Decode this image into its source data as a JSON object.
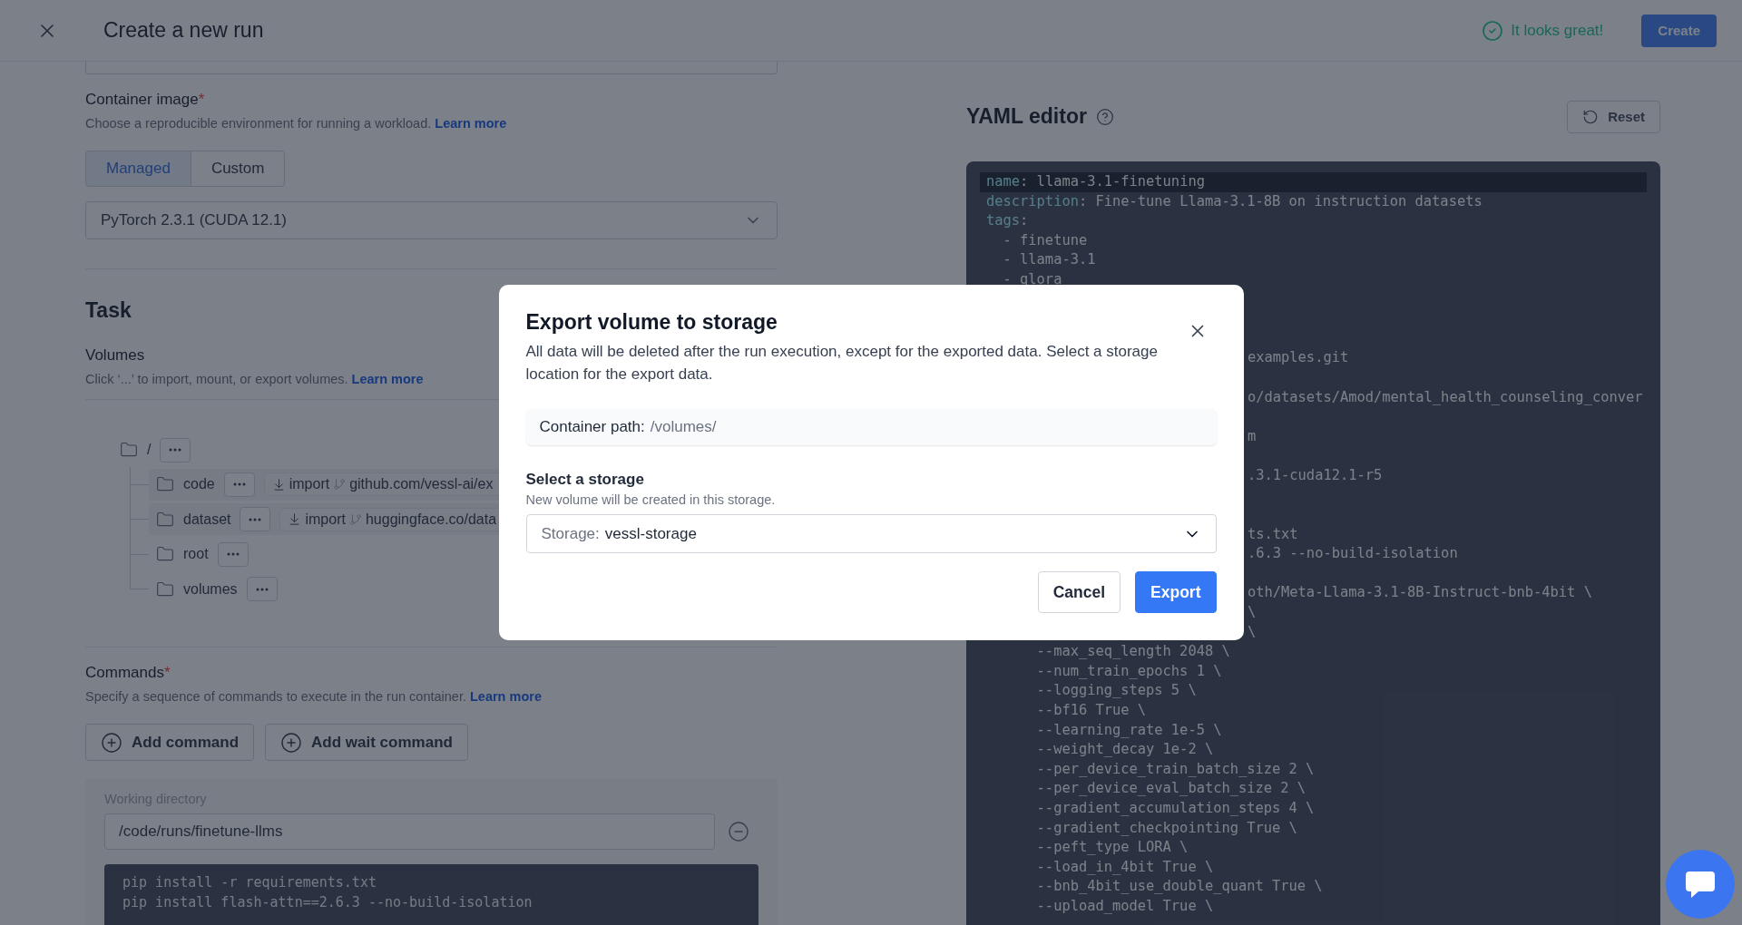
{
  "header": {
    "title": "Create a new run",
    "status": "It looks great!",
    "create_button": "Create"
  },
  "container_image": {
    "label": "Container image",
    "required_mark": "*",
    "description": "Choose a reproducible environment for running a workload.",
    "link": "Learn more",
    "options": [
      {
        "label": "Managed",
        "selected": true
      },
      {
        "label": "Custom",
        "selected": false
      }
    ],
    "image_select": "PyTorch 2.3.1 (CUDA 12.1)"
  },
  "task": {
    "heading": "Task",
    "volumes": {
      "label": "Volumes",
      "description": "Click ‘...’ to import, mount, or export volumes.",
      "link": "Learn more",
      "tree": {
        "name": "/",
        "children": [
          {
            "name": "code",
            "import": {
              "label": "import",
              "source": "github.com/vessl-ai/ex"
            }
          },
          {
            "name": "dataset",
            "import": {
              "label": "import",
              "source": "huggingface.co/data"
            }
          },
          {
            "name": "root"
          },
          {
            "name": "volumes"
          }
        ]
      }
    }
  },
  "commands": {
    "label": "Commands",
    "required_mark": "*",
    "description": "Specify a sequence of commands to execute in the run container.",
    "link": "Learn more",
    "buttons": [
      "Add command",
      "Add wait command"
    ],
    "working_directory": {
      "label": "Working directory",
      "value": "/code/runs/finetune-llms"
    },
    "script": [
      "pip install -r requirements.txt",
      "pip install flash-attn==2.6.3 --no-build-isolation"
    ]
  },
  "yaml_editor": {
    "title": "YAML editor",
    "reset": "Reset",
    "lines": [
      {
        "kind": "full",
        "key": "name",
        "text": ": llama-3.1-finetuning",
        "highlighted": true
      },
      {
        "kind": "full",
        "key": "description",
        "text": ": Fine-tune Llama-3.1-8B on instruction datasets",
        "highlighted": false
      },
      {
        "kind": "full",
        "key": "tags",
        "text": ":",
        "highlighted": false
      },
      {
        "kind": "full",
        "text": "  - finetune",
        "highlighted": false
      },
      {
        "kind": "full",
        "text": "  - llama-3.1",
        "highlighted": false
      },
      {
        "kind": "full",
        "text": "  - qlora",
        "highlighted": false
      },
      {
        "kind": "covered"
      },
      {
        "kind": "covered"
      },
      {
        "kind": "covered"
      },
      {
        "kind": "tail",
        "text": "examples.git",
        "highlighted": false
      },
      {
        "kind": "covered"
      },
      {
        "kind": "tail",
        "text": "o/datasets/Amod/mental_health_counseling_conver",
        "highlighted": false
      },
      {
        "kind": "covered"
      },
      {
        "kind": "tail",
        "text": "m",
        "highlighted": false
      },
      {
        "kind": "covered"
      },
      {
        "kind": "tail",
        "text": ".3.1-cuda12.1-r5",
        "highlighted": false
      },
      {
        "kind": "covered"
      },
      {
        "kind": "covered"
      },
      {
        "kind": "tail",
        "text": "ts.txt",
        "highlighted": false
      },
      {
        "kind": "tail",
        "text": ".6.3 --no-build-isolation",
        "highlighted": false
      },
      {
        "kind": "covered"
      },
      {
        "kind": "tail",
        "text": "oth/Meta-Llama-3.1-8B-Instruct-bnb-4bit \\",
        "highlighted": false
      },
      {
        "kind": "tail",
        "text": "\\",
        "highlighted": false
      },
      {
        "kind": "tail",
        "text": "\\",
        "highlighted": false
      },
      {
        "kind": "full",
        "text": "      --max_seq_length 2048 \\",
        "highlighted": false
      },
      {
        "kind": "full",
        "text": "      --num_train_epochs 1 \\",
        "highlighted": false
      },
      {
        "kind": "full",
        "text": "      --logging_steps 5 \\",
        "highlighted": false
      },
      {
        "kind": "full",
        "text": "      --bf16 True \\",
        "highlighted": false
      },
      {
        "kind": "full",
        "text": "      --learning_rate 1e-5 \\",
        "highlighted": false
      },
      {
        "kind": "full",
        "text": "      --weight_decay 1e-2 \\",
        "highlighted": false
      },
      {
        "kind": "full",
        "text": "      --per_device_train_batch_size 2 \\",
        "highlighted": false
      },
      {
        "kind": "full",
        "text": "      --per_device_eval_batch_size 2 \\",
        "highlighted": false
      },
      {
        "kind": "full",
        "text": "      --gradient_accumulation_steps 4 \\",
        "highlighted": false
      },
      {
        "kind": "full",
        "text": "      --gradient_checkpointing True \\",
        "highlighted": false
      },
      {
        "kind": "full",
        "text": "      --peft_type LORA \\",
        "highlighted": false
      },
      {
        "kind": "full",
        "text": "      --load_in_4bit True \\",
        "highlighted": false
      },
      {
        "kind": "full",
        "text": "      --bnb_4bit_use_double_quant True \\",
        "highlighted": false
      },
      {
        "kind": "full",
        "text": "      --upload_model True \\",
        "highlighted": false
      }
    ]
  },
  "dialog": {
    "title": "Export volume to storage",
    "description": "All data will be deleted after the run execution, except for the exported data. Select a storage location for the export data.",
    "container_path": {
      "label": "Container path:",
      "value": "/volumes/"
    },
    "storage_heading": "Select a storage",
    "storage_hint": "New volume will be created in this storage.",
    "storage_select": {
      "label": "Storage:",
      "value": "vessl-storage"
    },
    "buttons": [
      {
        "label": "Cancel",
        "kind": "secondary"
      },
      {
        "label": "Export",
        "kind": "primary"
      }
    ]
  }
}
